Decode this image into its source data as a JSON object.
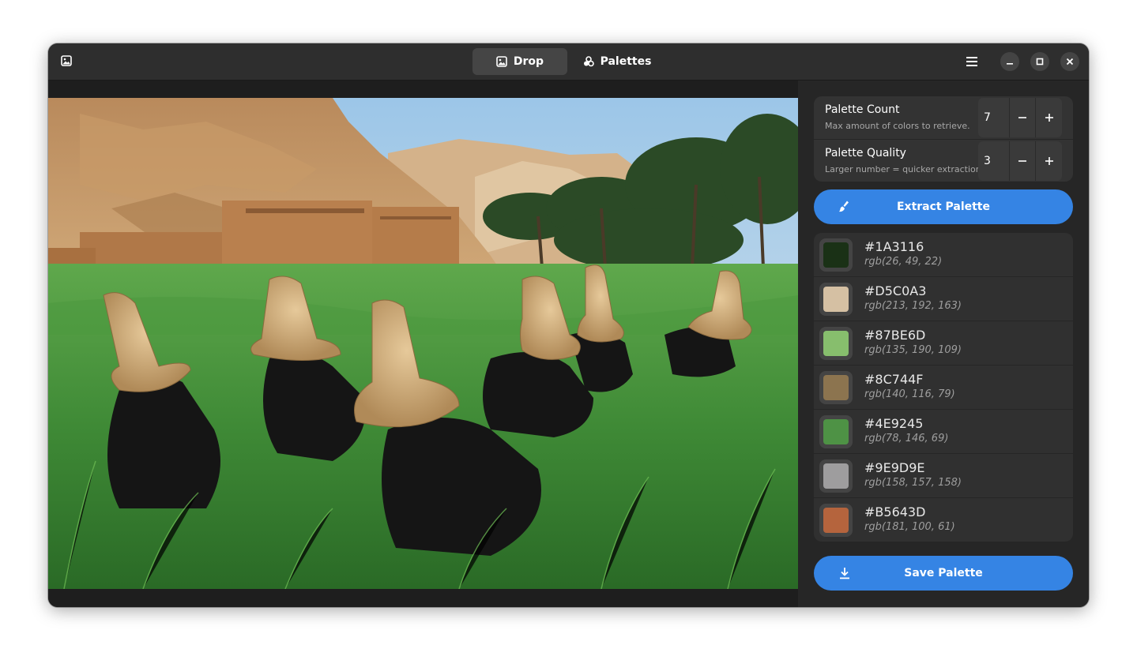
{
  "header": {
    "tabs": [
      {
        "label": "Drop",
        "icon": "image-icon",
        "active": true
      },
      {
        "label": "Palettes",
        "icon": "palettes-icon",
        "active": false
      }
    ]
  },
  "settings": {
    "palette_count": {
      "title": "Palette Count",
      "subtitle": "Max amount of colors to retrieve.",
      "value": "7"
    },
    "palette_quality": {
      "title": "Palette Quality",
      "subtitle": "Larger number = quicker extraction.",
      "value": "3"
    }
  },
  "extract_button": {
    "label": "Extract Palette",
    "icon": "brush-icon"
  },
  "palette": [
    {
      "hex": "#1A3116",
      "rgb": "rgb(26, 49, 22)"
    },
    {
      "hex": "#D5C0A3",
      "rgb": "rgb(213, 192, 163)"
    },
    {
      "hex": "#87BE6D",
      "rgb": "rgb(135, 190, 109)"
    },
    {
      "hex": "#8C744F",
      "rgb": "rgb(140, 116, 79)"
    },
    {
      "hex": "#4E9245",
      "rgb": "rgb(78, 146, 69)"
    },
    {
      "hex": "#9E9D9E",
      "rgb": "rgb(158, 157, 158)"
    },
    {
      "hex": "#B5643D",
      "rgb": "rgb(181, 100, 61)"
    }
  ],
  "save_button": {
    "label": "Save Palette",
    "icon": "download-icon"
  },
  "colors": {
    "accent": "#3584e4",
    "window_bg": "#1e1e1e",
    "headerbar_bg": "#2e2e2e"
  }
}
